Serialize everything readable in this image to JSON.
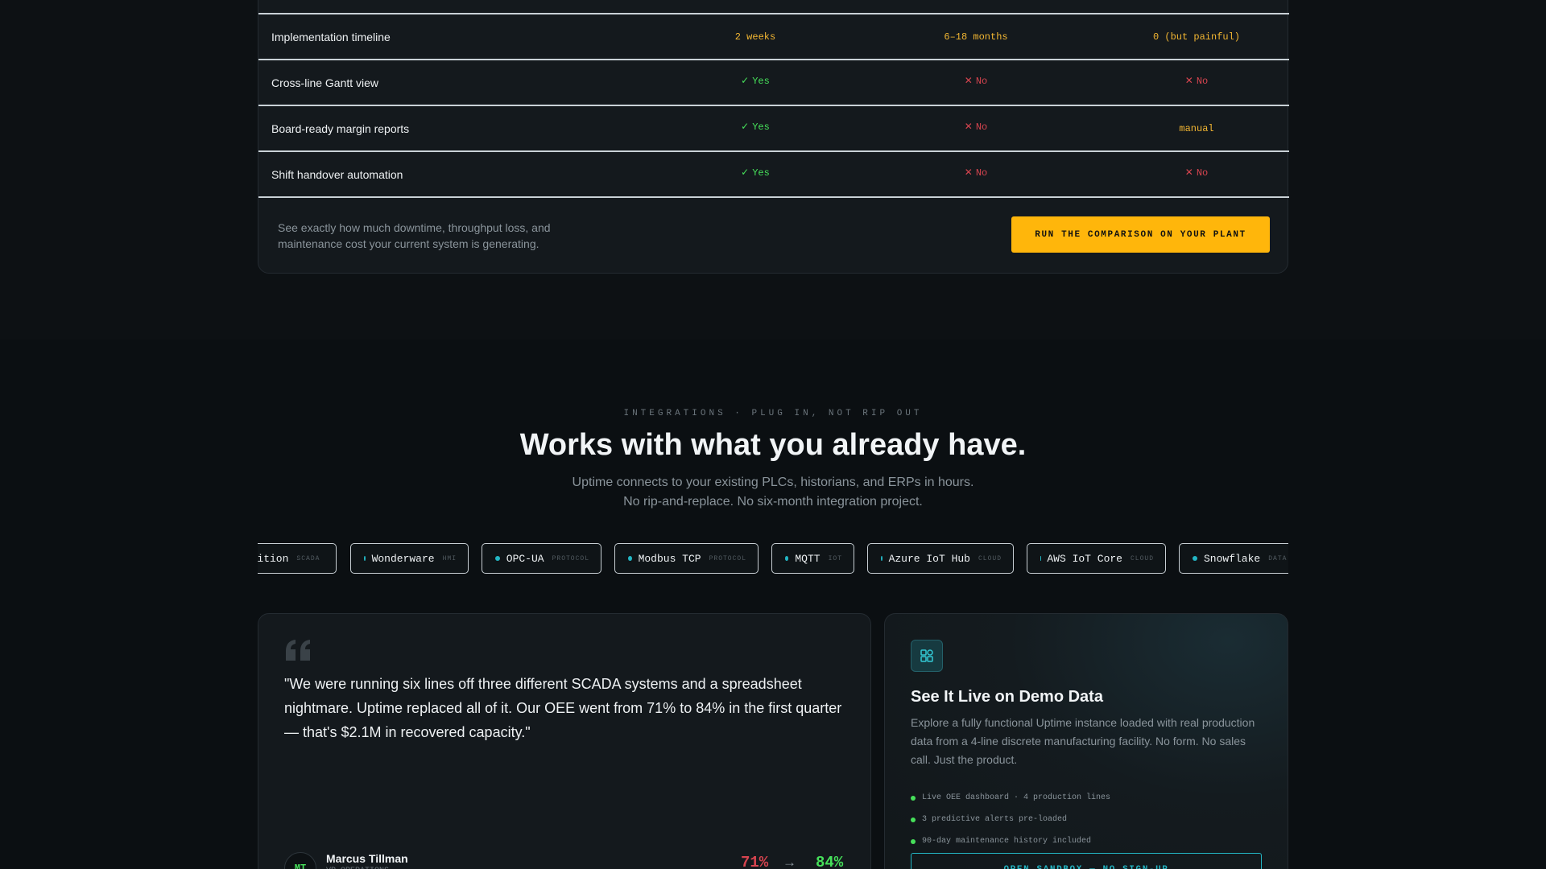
{
  "comparison": {
    "rows": [
      {
        "feature": "Implementation timeline",
        "cells": [
          {
            "kind": "text",
            "text": "2 weeks"
          },
          {
            "kind": "text",
            "text": "6–18 months"
          },
          {
            "kind": "text",
            "text": "0 (but painful)"
          }
        ]
      },
      {
        "feature": "Cross-line Gantt view",
        "cells": [
          {
            "kind": "yes",
            "text": "Yes"
          },
          {
            "kind": "no",
            "text": "No"
          },
          {
            "kind": "no",
            "text": "No"
          }
        ]
      },
      {
        "feature": "Board-ready margin reports",
        "cells": [
          {
            "kind": "yes",
            "text": "Yes"
          },
          {
            "kind": "no",
            "text": "No"
          },
          {
            "kind": "text",
            "text": "manual"
          }
        ]
      },
      {
        "feature": "Shift handover automation",
        "cells": [
          {
            "kind": "yes",
            "text": "Yes"
          },
          {
            "kind": "no",
            "text": "No"
          },
          {
            "kind": "no",
            "text": "No"
          }
        ]
      }
    ],
    "footer_note": "See exactly how much downtime, throughput loss, and maintenance cost your current system is generating.",
    "cta_label": "RUN THE COMPARISON ON YOUR PLANT"
  },
  "integrations": {
    "eyebrow": "INTEGRATIONS · PLUG IN, NOT RIP OUT",
    "headline": "Works with what you already have.",
    "subline_1": "Uptime connects to your existing PLCs, historians, and ERPs in hours.",
    "subline_2": "No rip-and-replace. No six-month integration project.",
    "chips": [
      {
        "name": "Ignition",
        "tag": "SCADA"
      },
      {
        "name": "Wonderware",
        "tag": "HMI"
      },
      {
        "name": "OPC-UA",
        "tag": "PROTOCOL"
      },
      {
        "name": "Modbus TCP",
        "tag": "PROTOCOL"
      },
      {
        "name": "MQTT",
        "tag": "IOT"
      },
      {
        "name": "Azure IoT Hub",
        "tag": "CLOUD"
      },
      {
        "name": "AWS IoT Core",
        "tag": "CLOUD"
      },
      {
        "name": "Snowflake",
        "tag": "DATA"
      }
    ]
  },
  "testimonial": {
    "quote": "\"We were running six lines off three different SCADA systems and a spreadsheet nightmare. Uptime replaced all of it. Our OEE went from 71% to 84% in the first quarter — that's $2.1M in recovered capacity.\"",
    "initials": "MT",
    "name": "Marcus Tillman",
    "role": "VP OPERATIONS",
    "metric_from": "71%",
    "metric_arrow": "→",
    "metric_to": "84%"
  },
  "demo": {
    "title": "See It Live on Demo Data",
    "description": "Explore a fully functional Uptime instance loaded with real production data from a 4-line discrete manufacturing facility. No form. No sales call. Just the product.",
    "features": [
      "Live OEE dashboard · 4 production lines",
      "3 predictive alerts pre-loaded",
      "90-day maintenance history included"
    ],
    "cta_label": "OPEN SANDBOX — NO SIGN-UP"
  },
  "colors": {
    "accent_amber": "#ffb60b",
    "accent_teal": "#23b6c4",
    "positive": "#46e05a",
    "negative": "#d6444f"
  },
  "icons": {
    "check": "check-icon",
    "cross": "x-icon",
    "quote": "quote-icon",
    "demo": "dashboard-icon"
  }
}
